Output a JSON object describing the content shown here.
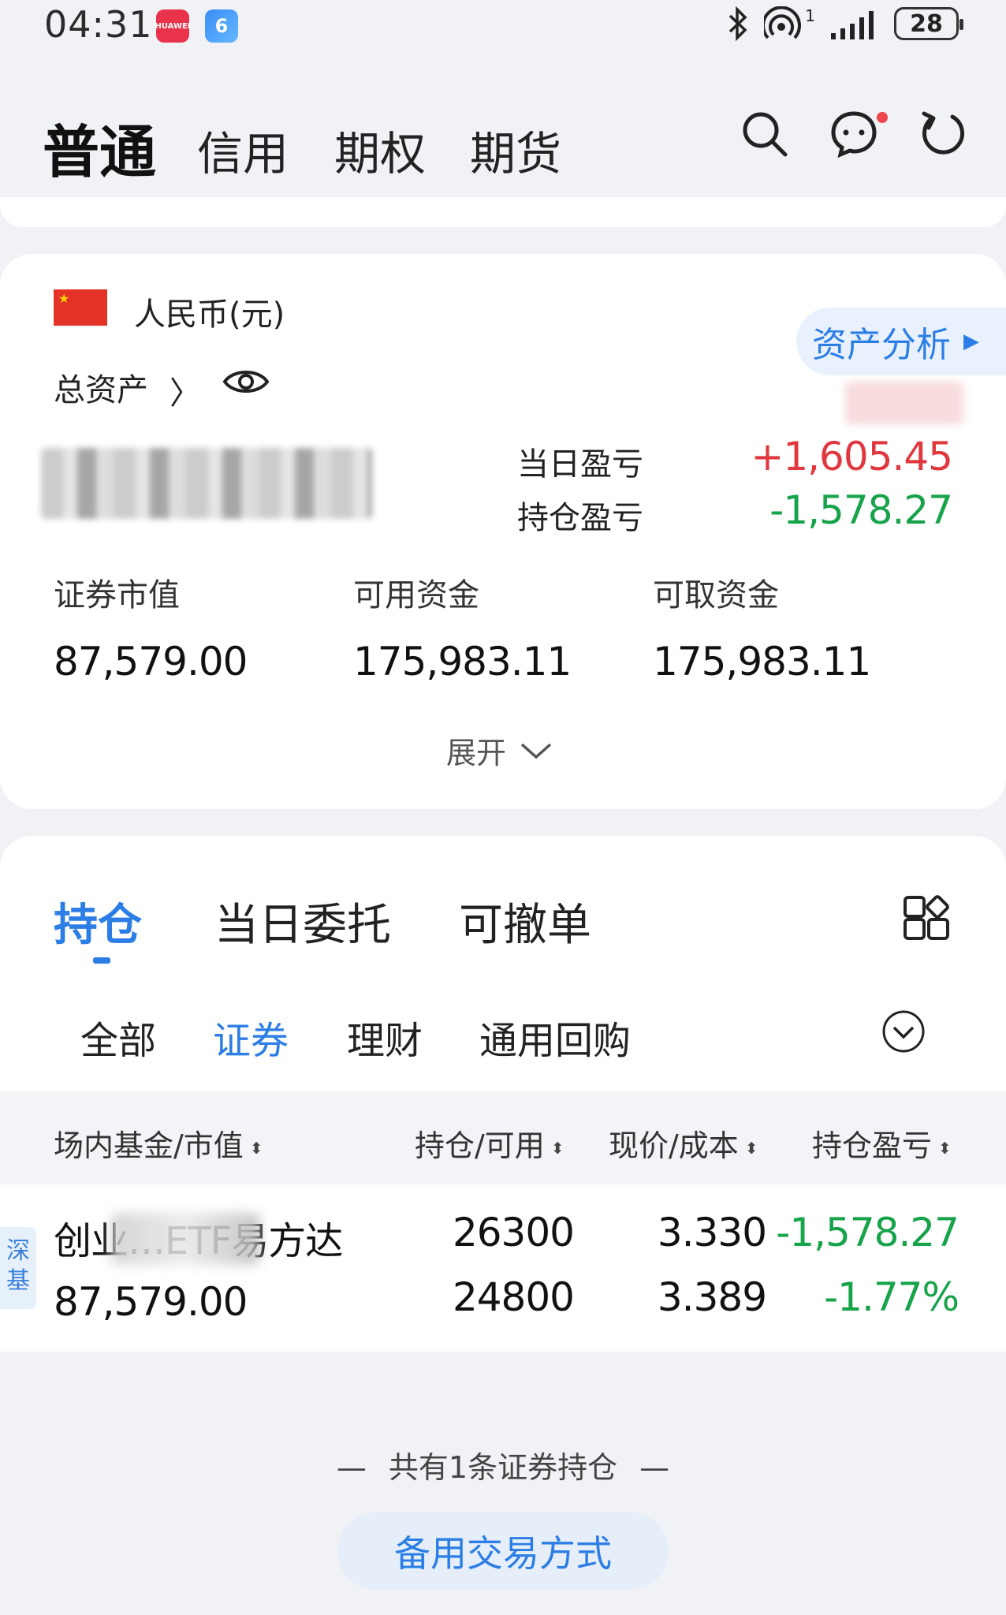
{
  "status_bar": {
    "time": "04:31",
    "huawei_icon_label": "HUAWEI",
    "six_icon_label": "6",
    "signal_label": "1",
    "battery": "28",
    "icons": [
      "bluetooth-icon",
      "hotspot-icon",
      "signal-icon",
      "battery-icon"
    ]
  },
  "header": {
    "tabs": [
      {
        "label": "普通",
        "active": true
      },
      {
        "label": "信用",
        "active": false
      },
      {
        "label": "期权",
        "active": false
      },
      {
        "label": "期货",
        "active": false
      }
    ],
    "icons": [
      "search-icon",
      "message-icon",
      "refresh-icon"
    ],
    "colors": {
      "unread_dot": "#f0474d"
    }
  },
  "asset_card": {
    "currency": "人民币(元)",
    "total_assets_label": "总资产",
    "analysis_button": "资产分析",
    "daily_pnl_label": "当日盈亏",
    "daily_pnl_value": "+1,605.45",
    "holding_pnl_label": "持仓盈亏",
    "holding_pnl_value": "-1,578.27",
    "metrics": [
      {
        "label": "证券市值",
        "value": "87,579.00"
      },
      {
        "label": "可用资金",
        "value": "175,983.11"
      },
      {
        "label": "可取资金",
        "value": "175,983.11"
      }
    ],
    "expand_label": "展开",
    "colors": {
      "profit": "#e0383e",
      "loss": "#17a34a",
      "accent": "#2c7ee6"
    }
  },
  "holdings": {
    "tabs": [
      {
        "label": "持仓",
        "active": true
      },
      {
        "label": "当日委托",
        "active": false
      },
      {
        "label": "可撤单",
        "active": false
      }
    ],
    "sub_tabs": [
      {
        "label": "全部",
        "active": false
      },
      {
        "label": "证券",
        "active": true
      },
      {
        "label": "理财",
        "active": false
      },
      {
        "label": "通用回购",
        "active": false
      }
    ],
    "columns": [
      "场内基金/市值",
      "持仓/可用",
      "现价/成本",
      "持仓盈亏"
    ],
    "rows": [
      {
        "market_badge": "深基",
        "name": "创业…ETF易方达",
        "market_value": "87,579.00",
        "position": "26300",
        "available": "24800",
        "price": "3.330",
        "cost": "3.389",
        "pnl": "-1,578.27",
        "pnl_pct": "-1.77%"
      }
    ],
    "footer_text": "共有1条证券持仓",
    "backup_button": "备用交易方式"
  }
}
